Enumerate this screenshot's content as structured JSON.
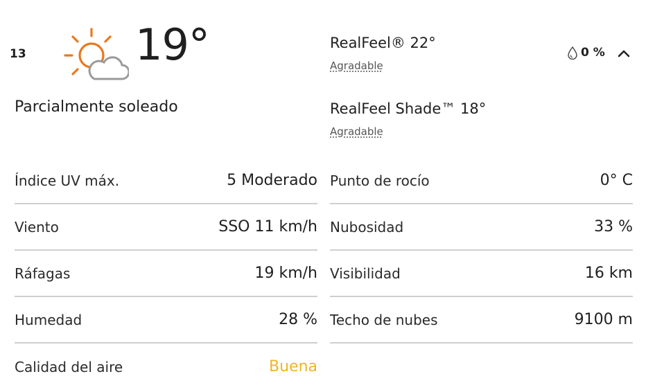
{
  "hour": "13",
  "icon": "partly-sunny-icon",
  "temperature": "19°",
  "phrase": "Parcialmente soleado",
  "realfeel": {
    "value": "RealFeel® 22°",
    "label": "Agradable"
  },
  "realfeel_shade": {
    "value": "RealFeel Shade™ 18°",
    "label": "Agradable"
  },
  "precipitation": "0 %",
  "colors": {
    "sun": "#e8791d",
    "cloud": "#9a9a9a",
    "air_quality_good": "#f0b429",
    "divider": "#cfcfcf"
  },
  "details_left": [
    {
      "label": "Índice UV máx.",
      "value": "5 Moderado"
    },
    {
      "label": "Viento",
      "value": "SSO 11 km/h"
    },
    {
      "label": "Ráfagas",
      "value": "19 km/h"
    },
    {
      "label": "Humedad",
      "value": "28 %"
    },
    {
      "label": "Calidad del aire",
      "value": "Buena"
    }
  ],
  "details_right": [
    {
      "label": "Punto de rocío",
      "value": "0° C"
    },
    {
      "label": "Nubosidad",
      "value": "33 %"
    },
    {
      "label": "Visibilidad",
      "value": "16 km"
    },
    {
      "label": "Techo de nubes",
      "value": "9100 m"
    }
  ]
}
